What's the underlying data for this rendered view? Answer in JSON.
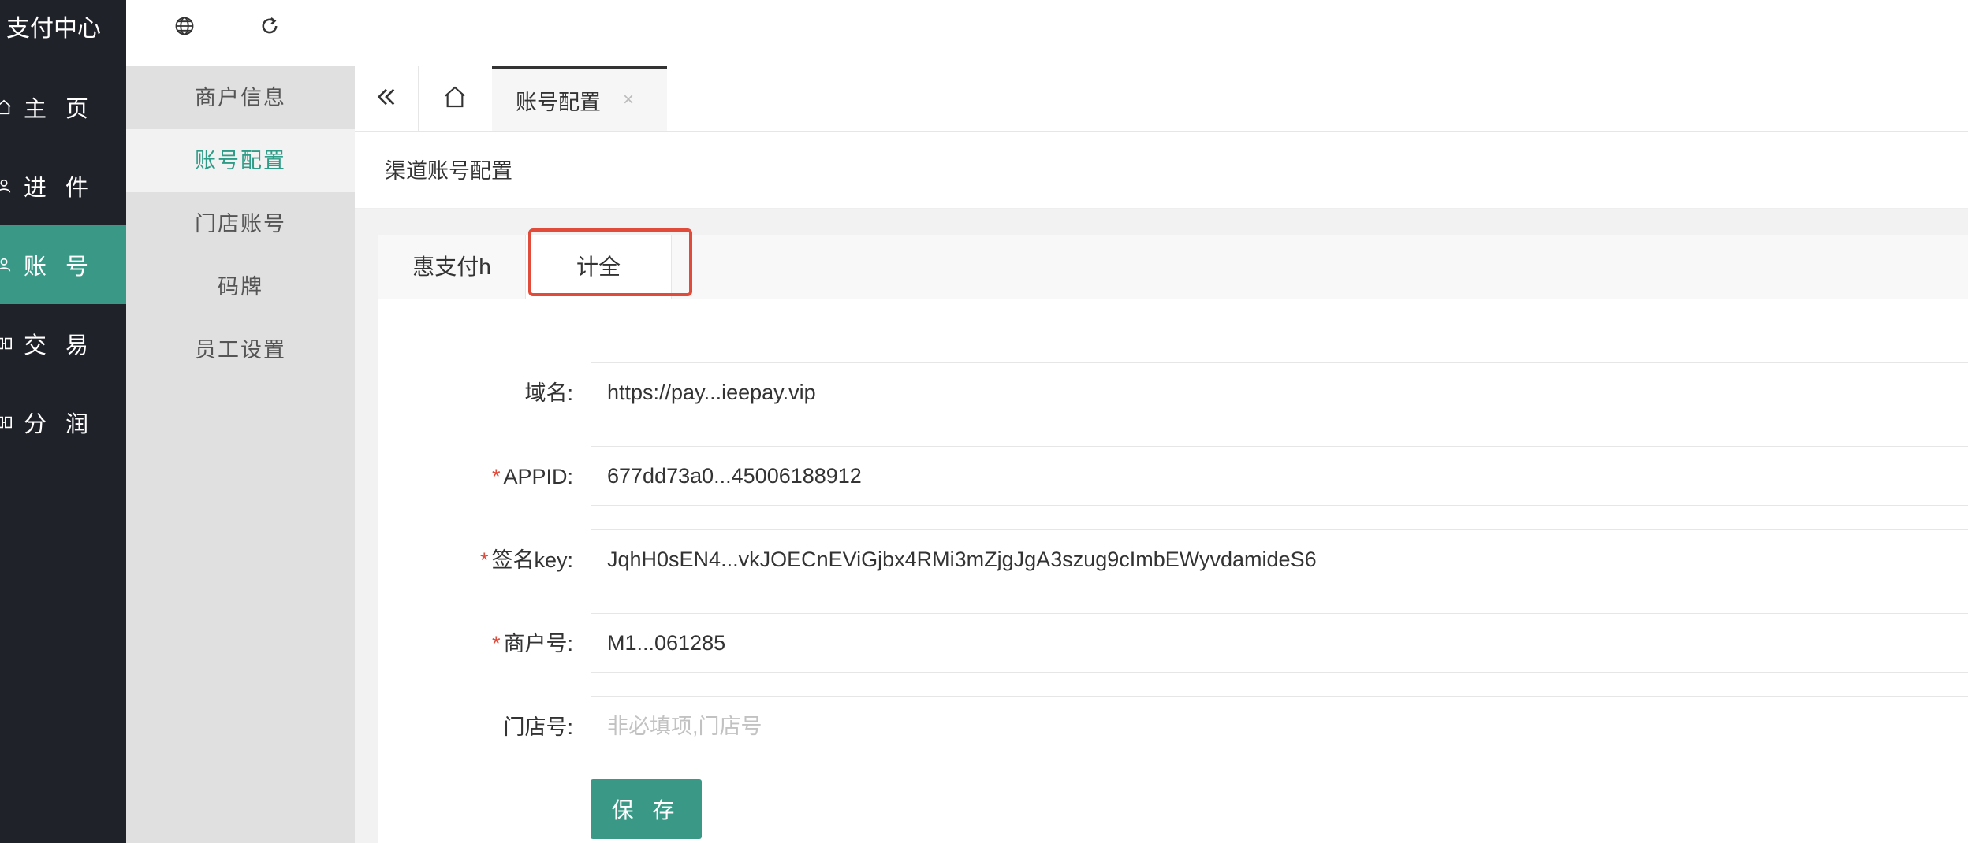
{
  "app": {
    "title": "支付中心"
  },
  "nav": {
    "items": [
      {
        "label": "主 页",
        "icon": "home-icon"
      },
      {
        "label": "进 件",
        "icon": "user-icon"
      },
      {
        "label": "账 号",
        "icon": "user-icon",
        "active": true
      },
      {
        "label": "交 易",
        "icon": "book-icon"
      },
      {
        "label": "分 润",
        "icon": "book-icon"
      }
    ]
  },
  "header": {
    "icons": [
      "globe-icon",
      "refresh-icon"
    ]
  },
  "submenu": {
    "items": [
      {
        "label": "商户信息"
      },
      {
        "label": "账号配置",
        "active": true
      },
      {
        "label": "门店账号"
      },
      {
        "label": "码牌"
      },
      {
        "label": "员工设置"
      }
    ]
  },
  "tabbar": {
    "page_tab": "账号配置",
    "close_glyph": "×"
  },
  "card": {
    "title": "渠道账号配置"
  },
  "channel_tabs": [
    {
      "label": "惠支付h"
    },
    {
      "label": "计全",
      "active": true
    }
  ],
  "form": {
    "domain": {
      "label": "域名:",
      "value": "https://pay...ieepay.vip",
      "required": false
    },
    "appid": {
      "label": "APPID:",
      "value": "677dd73a0...45006188912",
      "required": true
    },
    "sign_key": {
      "label": "签名key:",
      "value": "JqhH0sEN4...vkJOECnEViGjbx4RMi3mZjgJgA3szug9cImbEWyvdamideS6",
      "required": true
    },
    "merchant_no": {
      "label": "商户号:",
      "value": "M1...061285",
      "required": true
    },
    "store_no": {
      "label": "门店号:",
      "value": "",
      "placeholder": "非必填项,门店号",
      "required": false
    },
    "save_label": "保 存",
    "required_mark": "*"
  },
  "colors": {
    "nav_bg": "#20222a",
    "accent": "#3a9986",
    "accent_text": "#2f9c88",
    "highlight": "#e04b3a"
  }
}
